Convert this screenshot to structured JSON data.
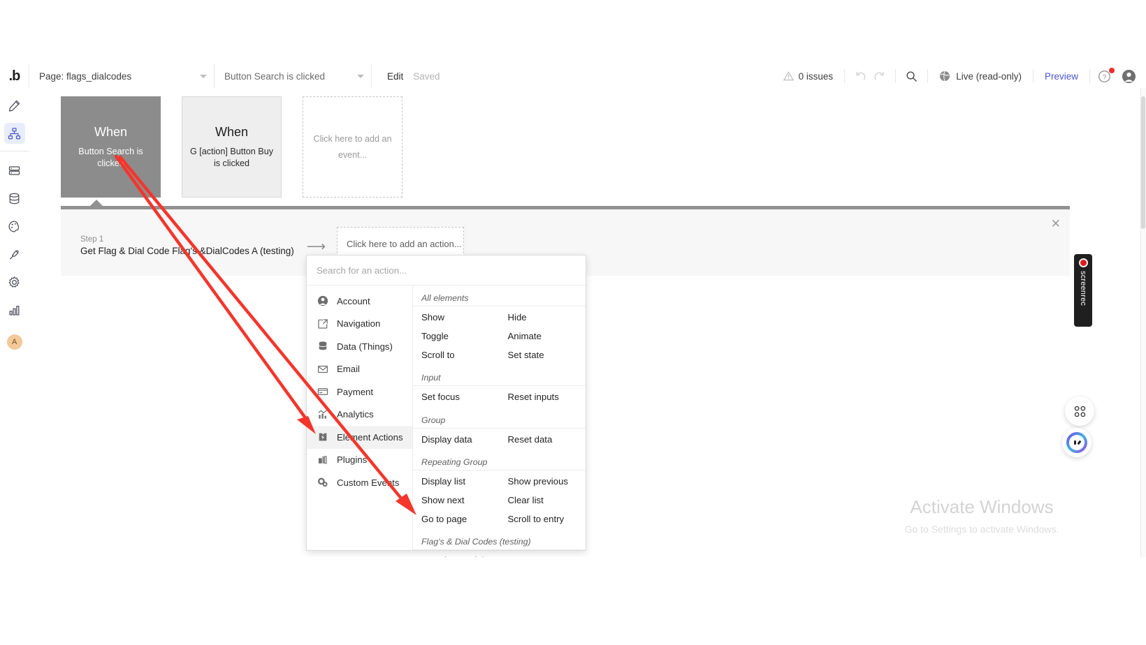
{
  "header": {
    "logo": "bubble-logo",
    "page_select": {
      "label": "Page: flags_dialcodes"
    },
    "event_select": {
      "label": "Button Search is clicked"
    },
    "edit_label": "Edit",
    "saved_label": "Saved",
    "issues_label": "0 issues",
    "undo_icon": "undo-icon",
    "redo_icon": "redo-icon",
    "search_icon": "search-icon",
    "live_label": "Live (read-only)",
    "preview_label": "Preview",
    "help_icon": "help-icon",
    "avatar_icon": "user-avatar-icon"
  },
  "sidebar": {
    "items": [
      {
        "name": "design",
        "icon": "pencil-icon",
        "active": false
      },
      {
        "name": "workflow",
        "icon": "workflow-nodes-icon",
        "active": true
      },
      {
        "name": "data-source",
        "icon": "server-icon",
        "active": false
      },
      {
        "name": "data",
        "icon": "database-icon",
        "active": false
      },
      {
        "name": "styles",
        "icon": "palette-icon",
        "active": false
      },
      {
        "name": "plugins",
        "icon": "plug-icon",
        "active": false
      },
      {
        "name": "settings",
        "icon": "gear-icon",
        "active": false
      },
      {
        "name": "logs",
        "icon": "bar-chart-icon",
        "active": false
      }
    ],
    "avatar_letter": "A",
    "collapse_icon": "collapse-arrow-icon"
  },
  "events": [
    {
      "when": "When",
      "desc": "Button Search is clicked",
      "state": "selected"
    },
    {
      "when": "When",
      "desc": "G [action] Button Buy is clicked",
      "state": "plain"
    },
    {
      "placeholder": "Click here to add an event...",
      "state": "empty"
    }
  ],
  "step_panel": {
    "step_number": "Step 1",
    "step_title": "Get Flag & Dial Code Flag's &DialCodes A (testing)",
    "arrow_icon": "arrow-right-icon",
    "add_action_placeholder": "Click here to add an action...",
    "close_icon": "close-icon"
  },
  "dropdown": {
    "search_placeholder": "Search for an action...",
    "categories": [
      {
        "label": "Account",
        "icon": "person-circle-icon",
        "active": false
      },
      {
        "label": "Navigation",
        "icon": "external-link-icon",
        "active": false
      },
      {
        "label": "Data (Things)",
        "icon": "database-stack-icon",
        "active": false
      },
      {
        "label": "Email",
        "icon": "envelope-icon",
        "active": false
      },
      {
        "label": "Payment",
        "icon": "credit-card-icon",
        "active": false
      },
      {
        "label": "Analytics",
        "icon": "chart-up-icon",
        "active": false
      },
      {
        "label": "Element Actions",
        "icon": "puzzle-bolt-icon",
        "active": true
      },
      {
        "label": "Plugins",
        "icon": "plugin-blocks-icon",
        "active": false
      },
      {
        "label": "Custom Events",
        "icon": "gears-icon",
        "active": false
      }
    ],
    "groups": [
      {
        "heading": "All elements",
        "rows": [
          [
            "Show",
            "Hide"
          ],
          [
            "Toggle",
            "Animate"
          ],
          [
            "Scroll to",
            "Set state"
          ]
        ]
      },
      {
        "heading": "Input",
        "rows": [
          [
            "Set focus",
            "Reset inputs"
          ]
        ]
      },
      {
        "heading": "Group",
        "rows": [
          [
            "Display data",
            "Reset data"
          ]
        ]
      },
      {
        "heading": "Repeating Group",
        "rows": [
          [
            "Display list",
            "Show previous"
          ],
          [
            "Show next",
            "Clear list"
          ],
          [
            "Go to page",
            "Scroll to entry"
          ]
        ]
      },
      {
        "heading": "Flag's & Dial Codes (testing)",
        "rows": [
          [
            "Get Flag & Dial Code a Flag's & Dial Codes (testing)"
          ]
        ]
      }
    ]
  },
  "widgets": {
    "screenrec_label": "screenrec",
    "screenrec_record_icon": "record-dot-icon",
    "grid_icon": "grid-apps-icon",
    "chat_icon": "chat-bot-icon"
  },
  "watermark": {
    "title": "Activate Windows",
    "subtitle": "Go to Settings to activate Windows."
  },
  "annotations": {
    "arrow_color": "#f5352b"
  }
}
